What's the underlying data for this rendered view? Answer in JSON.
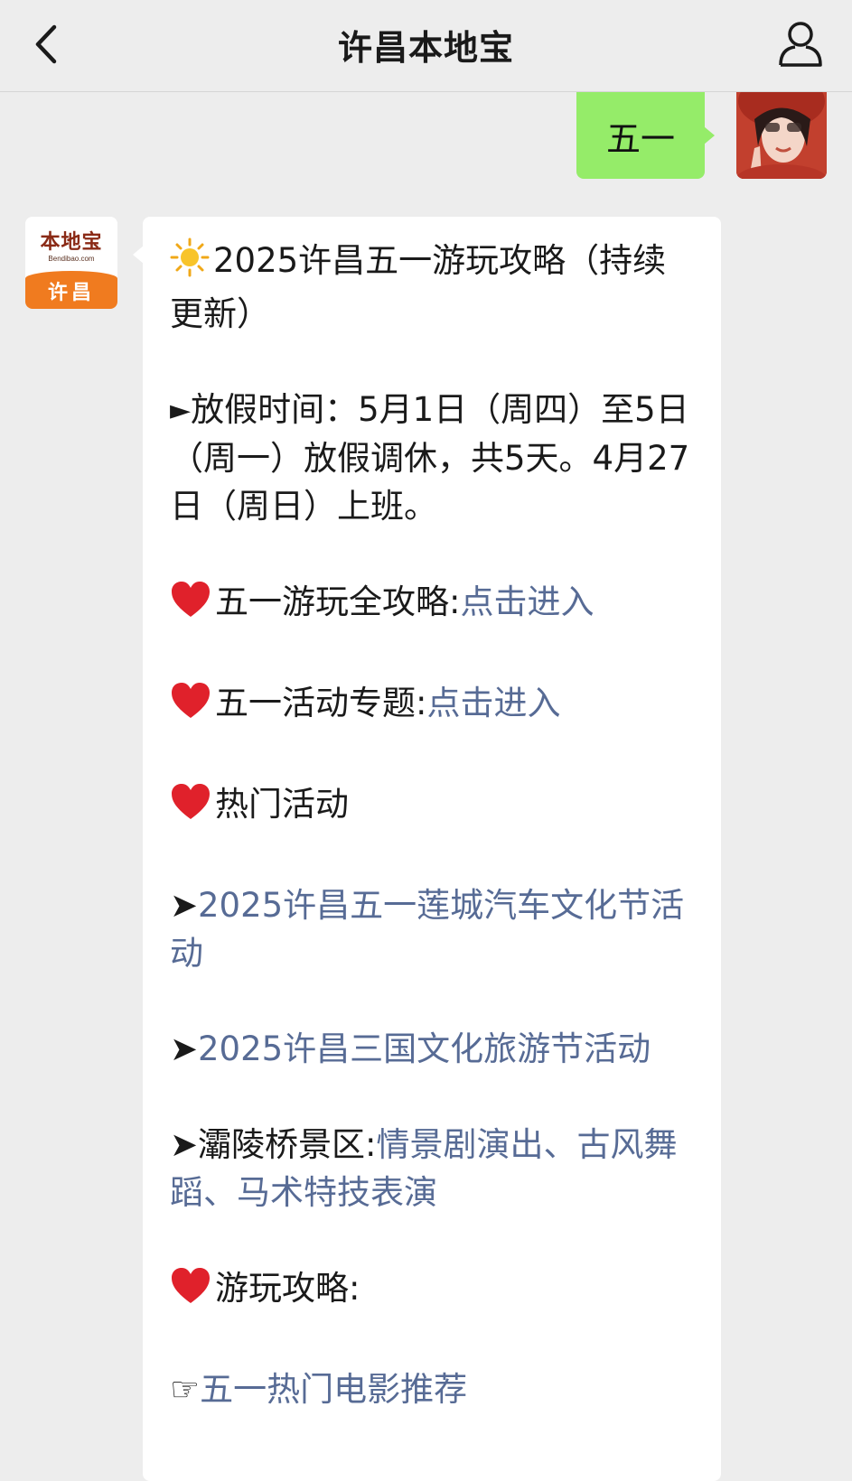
{
  "header": {
    "title": "许昌本地宝"
  },
  "outgoing_message": {
    "text": "五一"
  },
  "official_account": {
    "logo_brand": "本地宝",
    "logo_domain": "Bendibao.com",
    "logo_city": "许昌"
  },
  "incoming_message": {
    "title_text": "2025许昌五一游玩攻略（持续更新）",
    "holiday_prefix": "►",
    "holiday_text": "放假时间：5月1日（周四）至5日（周一）放假调休，共5天。4月27日（周日）上班。",
    "guide_label": "五一游玩全攻略:",
    "guide_link": "点击进入",
    "topic_label": "五一活动专题:",
    "topic_link": "点击进入",
    "hot_label": "热门活动",
    "arrow": "➤",
    "event1_link": "2025许昌五一莲城汽车文化节活动",
    "event2_link": "2025许昌三国文化旅游节活动",
    "scenic_label": "灞陵桥景区:",
    "scenic_link": "情景剧演出、古风舞蹈、马术特技表演",
    "tips_label": "游玩攻略:",
    "pointer": "☞",
    "movie_link": "五一热门电影推荐"
  },
  "colors": {
    "background": "#ededed",
    "outgoing_bubble": "#95ec69",
    "link": "#576b95"
  }
}
